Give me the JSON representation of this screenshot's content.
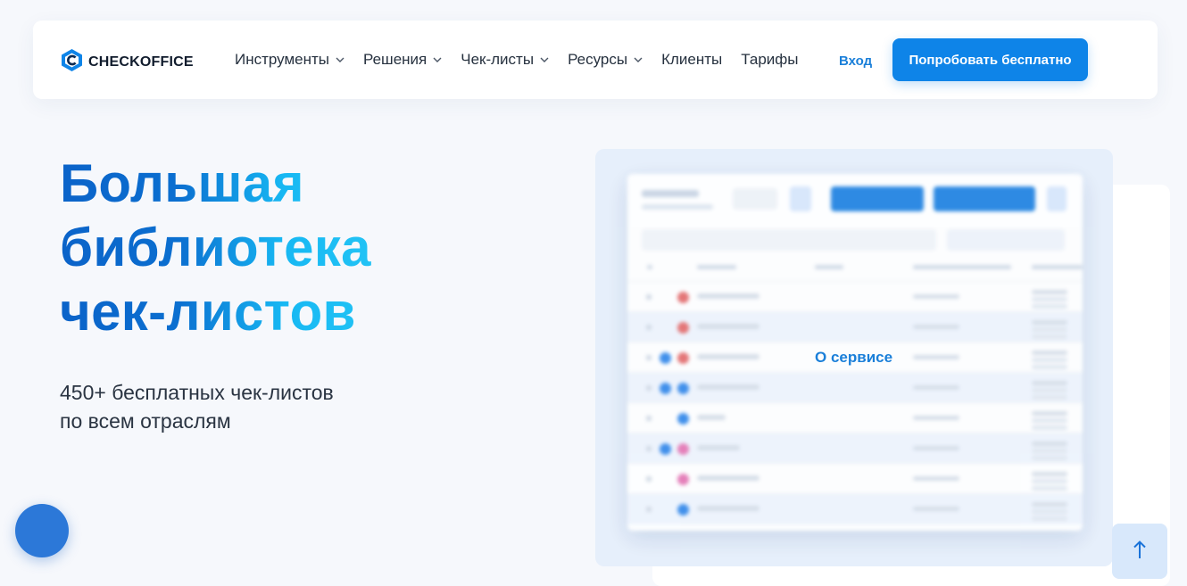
{
  "brand": {
    "name": "CHECKOFFICE",
    "colors": {
      "primary": "#0e84e8",
      "link": "#1a7fd9",
      "heading_dark": "#0b63c9",
      "heading_light": "#22c3f5"
    }
  },
  "nav": {
    "items": [
      {
        "label": "Инструменты",
        "has_dropdown": true,
        "icon": "chevron-down-icon"
      },
      {
        "label": "Решения",
        "has_dropdown": true,
        "icon": "chevron-down-icon"
      },
      {
        "label": "Чек-листы",
        "has_dropdown": true,
        "icon": "chevron-down-icon"
      },
      {
        "label": "Ресурсы",
        "has_dropdown": true,
        "icon": "chevron-down-icon"
      },
      {
        "label": "Клиенты",
        "has_dropdown": false
      },
      {
        "label": "Тарифы",
        "has_dropdown": false
      }
    ],
    "login_label": "Вход",
    "cta_label": "Попробовать бесплатно"
  },
  "hero": {
    "title_lines": [
      "Большая",
      "библиотека",
      "чек-листов"
    ],
    "subtitle_lines": [
      "450+ бесплатных чек-листов",
      "по всем отраслям"
    ]
  },
  "preview": {
    "overlay_label": "О сервисе"
  },
  "widgets": {
    "chat_icon": "chat-bubble-icon",
    "scroll_top_icon": "arrow-up-icon"
  }
}
